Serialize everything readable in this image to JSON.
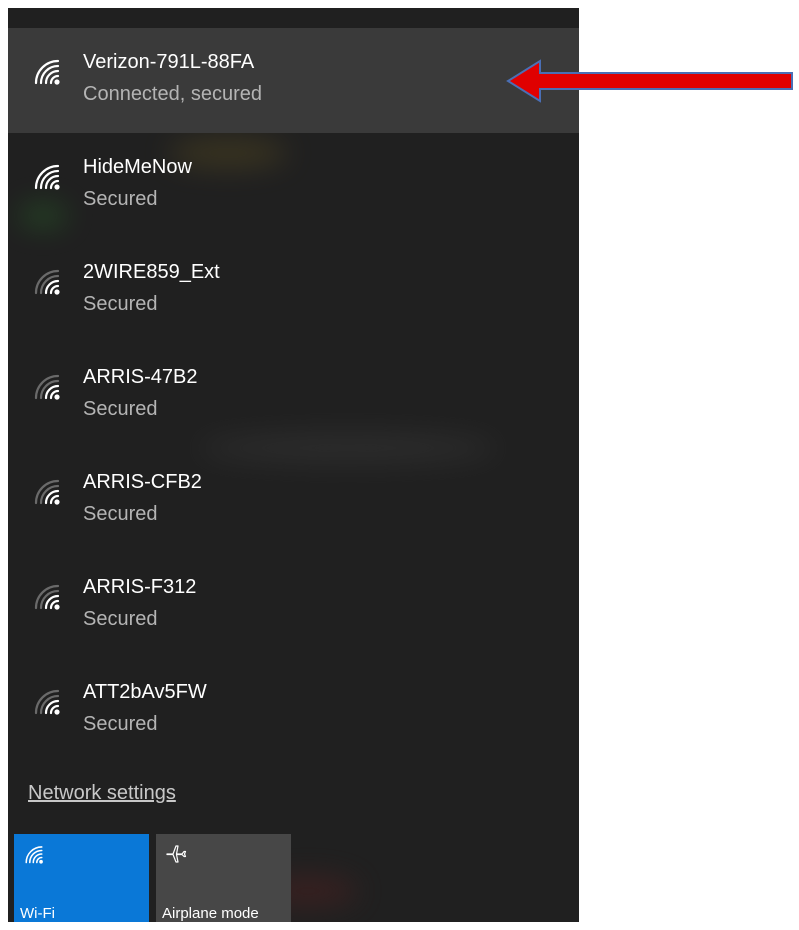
{
  "networks": [
    {
      "name": "Verizon-791L-88FA",
      "status": "Connected, secured",
      "selected": true,
      "signal_bars": 4
    },
    {
      "name": "HideMeNow",
      "status": "Secured",
      "selected": false,
      "signal_bars": 4
    },
    {
      "name": "2WIRE859_Ext",
      "status": "Secured",
      "selected": false,
      "signal_bars": 2
    },
    {
      "name": "ARRIS-47B2",
      "status": "Secured",
      "selected": false,
      "signal_bars": 2
    },
    {
      "name": "ARRIS-CFB2",
      "status": "Secured",
      "selected": false,
      "signal_bars": 2
    },
    {
      "name": "ARRIS-F312",
      "status": "Secured",
      "selected": false,
      "signal_bars": 2
    },
    {
      "name": "ATT2bAv5FW",
      "status": "Secured",
      "selected": false,
      "signal_bars": 2
    }
  ],
  "network_settings_label": "Network settings",
  "quick_actions": [
    {
      "label": "Wi-Fi",
      "icon": "wifi-icon",
      "active": true,
      "color": "#0a78d7"
    },
    {
      "label": "Airplane mode",
      "icon": "airplane-icon",
      "active": false,
      "color": "#474747"
    }
  ],
  "annotation": {
    "type": "arrow",
    "direction": "left",
    "color": "#e00000",
    "target": "Verizon-791L-88FA"
  },
  "colors": {
    "flyout_background": "#202020",
    "selected_row": "#3a3a3a",
    "accent": "#0a78d7"
  }
}
